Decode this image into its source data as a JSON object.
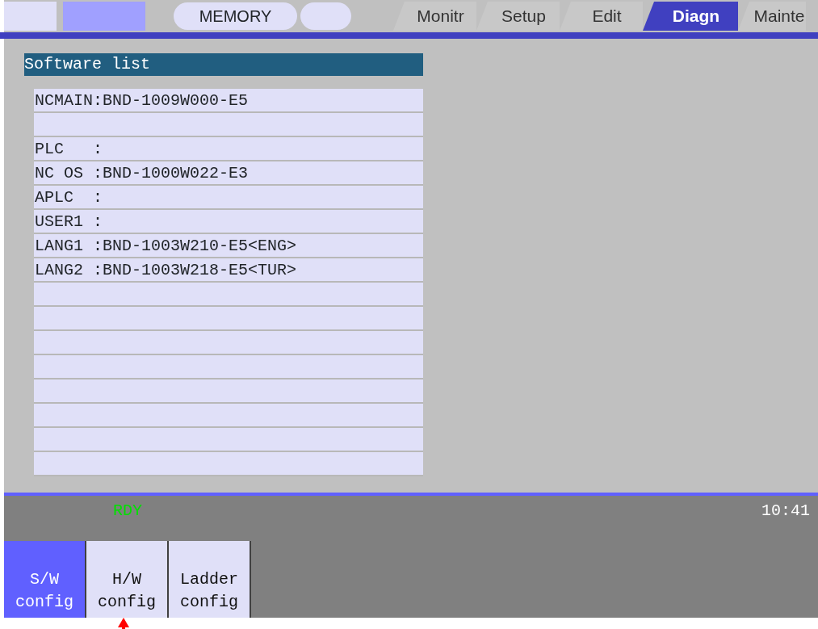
{
  "header": {
    "blocks": [
      {
        "kind": "plain"
      },
      {
        "kind": "highlight"
      }
    ],
    "mode": "MEMORY",
    "tabs": [
      {
        "label": "Monitr",
        "selected": false
      },
      {
        "label": "Setup",
        "selected": false
      },
      {
        "label": "Edit",
        "selected": false
      },
      {
        "label": "Diagn",
        "selected": true
      },
      {
        "label": "Mainte",
        "selected": false
      }
    ]
  },
  "panel": {
    "title": "Software list",
    "rows": [
      {
        "kind": "entry",
        "text": "NCMAIN:BND-1009W000-E5"
      },
      {
        "kind": "blank"
      },
      {
        "kind": "entry",
        "text": "PLC   :"
      },
      {
        "kind": "entry",
        "text": "NC OS :BND-1000W022-E3"
      },
      {
        "kind": "entry",
        "text": "APLC  :"
      },
      {
        "kind": "entry",
        "text": "USER1 :"
      },
      {
        "kind": "entry",
        "text": "LANG1 :BND-1003W210-E5<ENG>"
      },
      {
        "kind": "entry",
        "text": "LANG2 :BND-1003W218-E5<TUR>"
      },
      {
        "kind": "blank"
      },
      {
        "kind": "blank"
      },
      {
        "kind": "blank"
      },
      {
        "kind": "blank"
      },
      {
        "kind": "blank"
      },
      {
        "kind": "blank"
      },
      {
        "kind": "blank"
      },
      {
        "kind": "blank"
      }
    ]
  },
  "status_bar": {
    "state": "RDY",
    "time": "10:41"
  },
  "softkeys": [
    {
      "lines": [
        "S/W",
        "config"
      ],
      "selected": true
    },
    {
      "lines": [
        "H/W",
        "config"
      ],
      "selected": false
    },
    {
      "lines": [
        "Ladder",
        "config"
      ],
      "selected": false
    }
  ]
}
